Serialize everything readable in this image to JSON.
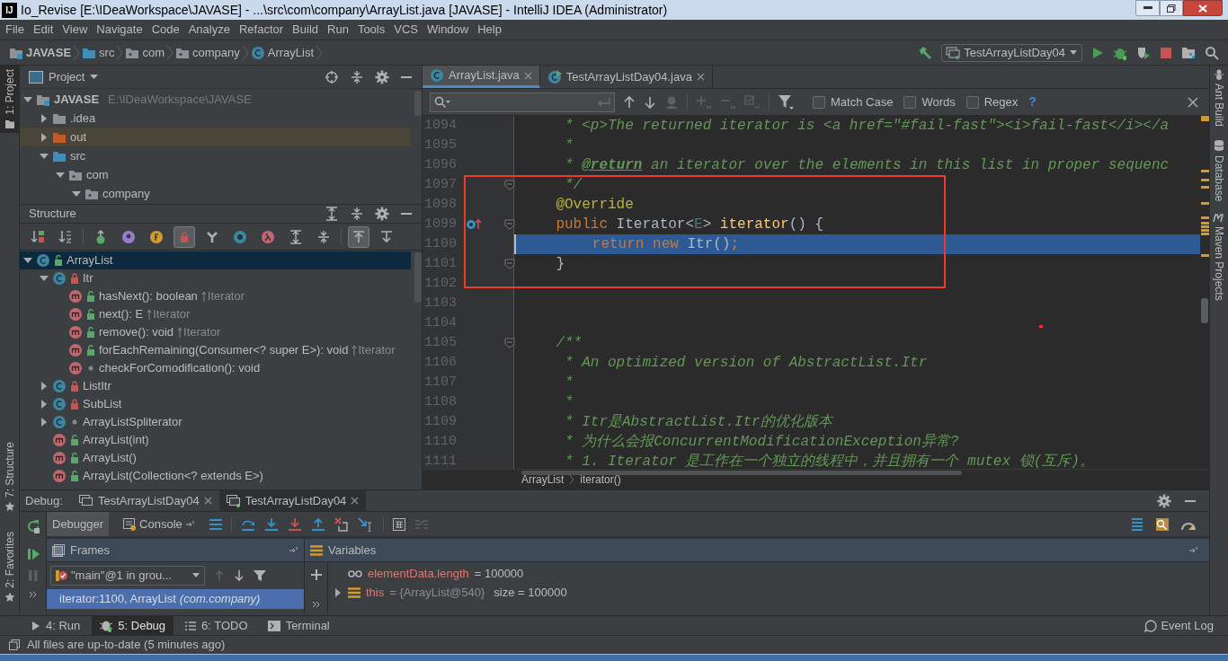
{
  "window": {
    "logo": "IJ",
    "title": "Io_Revise [E:\\IDeaWorkspace\\JAVASE] - ...\\src\\com\\company\\ArrayList.java [JAVASE] - IntelliJ IDEA (Administrator)"
  },
  "menu": [
    "File",
    "Edit",
    "View",
    "Navigate",
    "Code",
    "Analyze",
    "Refactor",
    "Build",
    "Run",
    "Tools",
    "VCS",
    "Window",
    "Help"
  ],
  "nav_bar": {
    "crumbs": [
      {
        "label": "JAVASE",
        "kind": "module"
      },
      {
        "label": "src",
        "kind": "source-folder"
      },
      {
        "label": "com",
        "kind": "package"
      },
      {
        "label": "company",
        "kind": "package"
      },
      {
        "label": "ArrayList",
        "kind": "class"
      }
    ],
    "run_config": "TestArrayListDay04"
  },
  "left_stripe": [
    {
      "label": "1: Project",
      "selected": true,
      "kind": "top"
    },
    {
      "label": "7: Structure",
      "selected": false,
      "kind": "bottom"
    },
    {
      "label": "2: Favorites",
      "selected": false,
      "kind": "bottom"
    }
  ],
  "project": {
    "title": "Project",
    "tree": [
      {
        "label": "JAVASE",
        "path": "E:\\IDeaWorkspace\\JAVASE",
        "kind": "module",
        "expanded": true,
        "children": [
          {
            "label": ".idea",
            "kind": "folder",
            "expanded": false
          },
          {
            "label": "out",
            "kind": "excluded-folder",
            "expanded": false
          },
          {
            "label": "src",
            "kind": "source-folder",
            "expanded": true,
            "children": [
              {
                "label": "com",
                "kind": "package",
                "expanded": true,
                "children": [
                  {
                    "label": "company",
                    "kind": "package",
                    "expanded": true
                  }
                ]
              }
            ]
          }
        ]
      }
    ]
  },
  "structure": {
    "title": "Structure",
    "toolbar": [
      {
        "kind": "sort-visibility",
        "on": false
      },
      {
        "kind": "sort-alpha",
        "on": false
      },
      {
        "kind": "inherited",
        "on": false
      },
      {
        "kind": "properties",
        "on": false
      },
      {
        "kind": "fields",
        "on": false
      },
      {
        "kind": "non-public",
        "on": true
      },
      {
        "kind": "anonymous",
        "on": false
      },
      {
        "kind": "interface",
        "on": false
      },
      {
        "kind": "lambdas",
        "on": false
      },
      {
        "kind": "expand-all",
        "on": false
      },
      {
        "kind": "collapse-all",
        "on": false
      },
      {
        "kind": "autoscroll-to-source",
        "on": true
      },
      {
        "kind": "autoscroll-from-source",
        "on": false
      }
    ],
    "items": [
      {
        "label": "ArrayList",
        "kind": "public-class",
        "expanded": true,
        "selected": true,
        "children": [
          {
            "label": "Itr",
            "kind": "private-class",
            "expanded": true,
            "selected": false,
            "children": [
              {
                "label": "hasNext(): boolean",
                "kind": "public-method",
                "overrides": "Iterator",
                "selected": false
              },
              {
                "label": "next(): E",
                "kind": "public-method",
                "overrides": "Iterator",
                "selected": false
              },
              {
                "label": "remove(): void",
                "kind": "public-method",
                "overrides": "Iterator",
                "selected": false
              },
              {
                "label": "forEachRemaining(Consumer<? super E>): void",
                "kind": "public-method",
                "overrides": "Iterator",
                "selected": false
              },
              {
                "label": "checkForComodification(): void",
                "kind": "package-method",
                "selected": false
              }
            ]
          },
          {
            "label": "ListItr",
            "kind": "private-class",
            "expanded": false,
            "selected": false
          },
          {
            "label": "SubList",
            "kind": "private-class",
            "expanded": false,
            "selected": false
          },
          {
            "label": "ArrayListSpliterator",
            "kind": "package-class",
            "expanded": false,
            "selected": false
          },
          {
            "label": "ArrayList(int)",
            "kind": "public-method",
            "selected": false
          },
          {
            "label": "ArrayList()",
            "kind": "public-method",
            "selected": false
          },
          {
            "label": "ArrayList(Collection<? extends E>)",
            "kind": "public-method",
            "selected": false
          }
        ]
      }
    ]
  },
  "editor": {
    "tabs": [
      {
        "label": "ArrayList.java",
        "kind": "class",
        "selected": true
      },
      {
        "label": "TestArrayListDay04.java",
        "kind": "runnable-class",
        "selected": false
      }
    ],
    "find": {
      "options": [
        {
          "label": "Match Case",
          "checked": false
        },
        {
          "label": "Words",
          "checked": false
        },
        {
          "label": "Regex",
          "checked": false
        }
      ],
      "help": "?"
    },
    "lines": [
      {
        "number": "1094",
        "current": false,
        "fold": false,
        "segments": [
          {
            "kind": "comment",
            "text": "     * <p>The returned iterator is <a href=\"#fail-fast\"><i>fail-fast</i></a"
          }
        ]
      },
      {
        "number": "1095",
        "current": false,
        "fold": false,
        "segments": [
          {
            "kind": "comment",
            "text": "     *"
          }
        ]
      },
      {
        "number": "1096",
        "current": false,
        "fold": false,
        "segments": [
          {
            "kind": "comment",
            "text": "     * "
          },
          {
            "kind": "doc-tag",
            "text": "@return"
          },
          {
            "kind": "comment",
            "text": " an iterator over the elements in this list in proper sequenc"
          }
        ]
      },
      {
        "number": "1097",
        "current": false,
        "fold": true,
        "segments": [
          {
            "kind": "comment",
            "text": "     */"
          }
        ]
      },
      {
        "number": "1098",
        "current": false,
        "fold": false,
        "segments": [
          {
            "kind": "annotation",
            "text": "    @Override"
          }
        ]
      },
      {
        "number": "1099",
        "current": false,
        "fold": true,
        "override": true,
        "segments": [
          {
            "kind": "keyword",
            "text": "    public"
          },
          {
            "kind": "plain",
            "text": " Iterator<"
          },
          {
            "kind": "type-param",
            "text": "E"
          },
          {
            "kind": "plain",
            "text": "> "
          },
          {
            "kind": "method",
            "text": "iterator"
          },
          {
            "kind": "plain",
            "text": "() {"
          }
        ]
      },
      {
        "number": "1100",
        "current": true,
        "fold": false,
        "segments": [
          {
            "kind": "keyword",
            "text": "        return new"
          },
          {
            "kind": "plain",
            "text": " Itr()"
          },
          {
            "kind": "keyword",
            "text": ";"
          }
        ]
      },
      {
        "number": "1101",
        "current": false,
        "fold": true,
        "segments": [
          {
            "kind": "plain",
            "text": "    }"
          }
        ]
      },
      {
        "number": "1102",
        "current": false,
        "fold": false
      },
      {
        "number": "1103",
        "current": false,
        "fold": false
      },
      {
        "number": "1104",
        "current": false,
        "fold": false
      },
      {
        "number": "1105",
        "current": false,
        "fold": true,
        "segments": [
          {
            "kind": "comment",
            "text": "    /**"
          }
        ]
      },
      {
        "number": "1106",
        "current": false,
        "fold": false,
        "segments": [
          {
            "kind": "comment",
            "text": "     * An optimized version of AbstractList.Itr"
          }
        ]
      },
      {
        "number": "1107",
        "current": false,
        "fold": false,
        "segments": [
          {
            "kind": "comment",
            "text": "     *"
          }
        ]
      },
      {
        "number": "1108",
        "current": false,
        "fold": false,
        "segments": [
          {
            "kind": "comment",
            "text": "     *"
          }
        ]
      },
      {
        "number": "1109",
        "current": false,
        "fold": false,
        "segments": [
          {
            "kind": "comment",
            "text": "     * Itr是AbstractList.Itr的优化版本"
          }
        ]
      },
      {
        "number": "1110",
        "current": false,
        "fold": false,
        "segments": [
          {
            "kind": "comment",
            "text": "     * 为什么会报ConcurrentModificationException异常?"
          }
        ]
      },
      {
        "number": "1111",
        "current": false,
        "fold": false,
        "segments": [
          {
            "kind": "comment",
            "text": "     * 1. Iterator 是工作在一个独立的线程中，并且拥有一个 mutex 锁(互斥)。"
          }
        ]
      }
    ],
    "breadcrumb": [
      "ArrayList",
      "iterator()"
    ]
  },
  "right_stripe": [
    "Ant Build",
    "Database",
    "Maven Projects"
  ],
  "debug": {
    "title": "Debug:",
    "sessions": [
      {
        "label": "TestArrayListDay04",
        "selected": false
      },
      {
        "label": "TestArrayListDay04",
        "selected": true
      }
    ],
    "tabs": [
      {
        "label": "Debugger",
        "selected": true
      },
      {
        "label": "Console",
        "selected": false
      }
    ],
    "frames": {
      "title": "Frames",
      "thread": "\"main\"@1 in grou...",
      "items": [
        {
          "method": "iterator:1100, ArrayList",
          "package": "(com.company)",
          "selected": true
        }
      ]
    },
    "variables": {
      "title": "Variables",
      "items": [
        {
          "kind": "watch",
          "name": "elementData.length",
          "value": "= 100000"
        },
        {
          "kind": "object",
          "name": "this",
          "ref": "= {ArrayList@540}",
          "value": "size = 100000",
          "expanded": false
        }
      ]
    }
  },
  "bottom_tabs": [
    {
      "label": "4: Run",
      "kind": "run",
      "selected": false
    },
    {
      "label": "5: Debug",
      "kind": "debug",
      "selected": true
    },
    {
      "label": "6: TODO",
      "kind": "todo",
      "selected": false
    },
    {
      "label": "Terminal",
      "kind": "terminal",
      "selected": false
    }
  ],
  "event_log": "Event Log",
  "status": "All files are up-to-date (5 minutes ago)"
}
